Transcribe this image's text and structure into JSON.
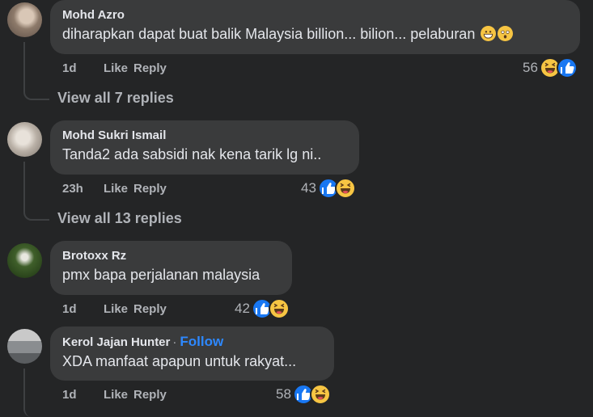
{
  "comments": [
    {
      "author": "Mohd Azro",
      "text": "diharapkan dapat buat balik Malaysia billion... bilion... pelaburan",
      "time": "1d",
      "like": "Like",
      "reply": "Reply",
      "reactions_count": "56",
      "reaction_icons": [
        "haha-icon",
        "like-icon"
      ],
      "view_replies": "View all 7 replies",
      "inline_emojis": [
        "grinning-emoji",
        "astonished-emoji"
      ]
    },
    {
      "author": "Mohd Sukri Ismail",
      "text": "Tanda2 ada sabsidi nak kena tarik lg ni..",
      "time": "23h",
      "like": "Like",
      "reply": "Reply",
      "reactions_count": "43",
      "reaction_icons": [
        "like-icon",
        "haha-icon"
      ],
      "view_replies": "View all 13 replies"
    },
    {
      "author": "Brotoxx Rz",
      "text": "pmx bapa perjalanan malaysia",
      "time": "1d",
      "like": "Like",
      "reply": "Reply",
      "reactions_count": "42",
      "reaction_icons": [
        "like-icon",
        "haha-icon"
      ]
    },
    {
      "author": "Kerol Jajan Hunter",
      "separator": "·",
      "follow": "Follow",
      "text": "XDA manfaat apapun untuk rakyat...",
      "time": "1d",
      "like": "Like",
      "reply": "Reply",
      "reactions_count": "58",
      "reaction_icons": [
        "like-icon",
        "haha-icon"
      ]
    }
  ],
  "colors": {
    "background": "#242526",
    "bubble": "#3a3b3c",
    "primary_text": "#e4e6eb",
    "secondary_text": "#b0b3b8",
    "link": "#2d88ff",
    "like_blue": "#1877f2",
    "haha_yellow": "#f7c543"
  }
}
